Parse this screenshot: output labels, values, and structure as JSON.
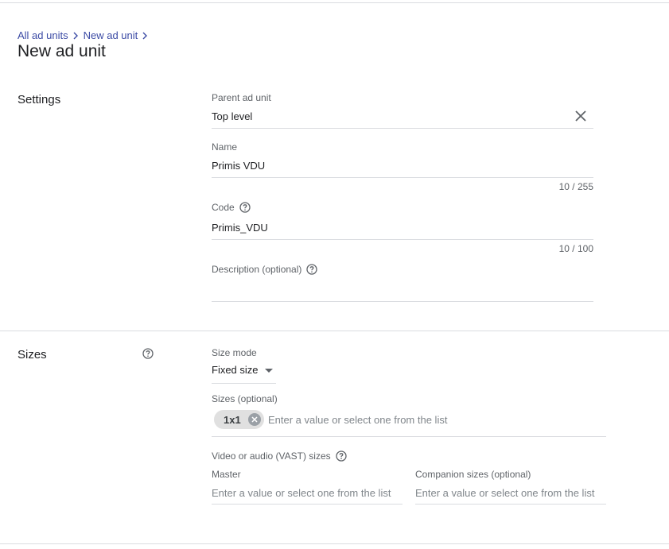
{
  "breadcrumb": {
    "item1": "All ad units",
    "item2": "New ad unit"
  },
  "page": {
    "title": "New ad unit"
  },
  "settings": {
    "section_label": "Settings",
    "parent": {
      "label": "Parent ad unit",
      "value": "Top level"
    },
    "name": {
      "label": "Name",
      "value": "Primis VDU",
      "counter": "10 / 255"
    },
    "code": {
      "label": "Code",
      "value": "Primis_VDU",
      "counter": "10 / 100"
    },
    "description": {
      "label": "Description (optional)",
      "value": ""
    }
  },
  "sizes": {
    "section_label": "Sizes",
    "size_mode": {
      "label": "Size mode",
      "value": "Fixed size"
    },
    "sizes_field": {
      "label": "Sizes (optional)",
      "chip": "1x1",
      "placeholder": "Enter a value or select one from the list"
    },
    "vast": {
      "label": "Video or audio (VAST) sizes"
    },
    "master": {
      "label": "Master",
      "placeholder": "Enter a value or select one from the list"
    },
    "companion": {
      "label": "Companion sizes (optional)",
      "placeholder": "Enter a value or select one from the list"
    }
  },
  "colors": {
    "link": "#3c4ba5",
    "divider": "#dadce0",
    "chip_bg": "#e0e0e0"
  },
  "icons": [
    "chevron-right-icon",
    "close-icon",
    "help-icon",
    "dropdown-caret-icon",
    "chip-remove-icon"
  ]
}
